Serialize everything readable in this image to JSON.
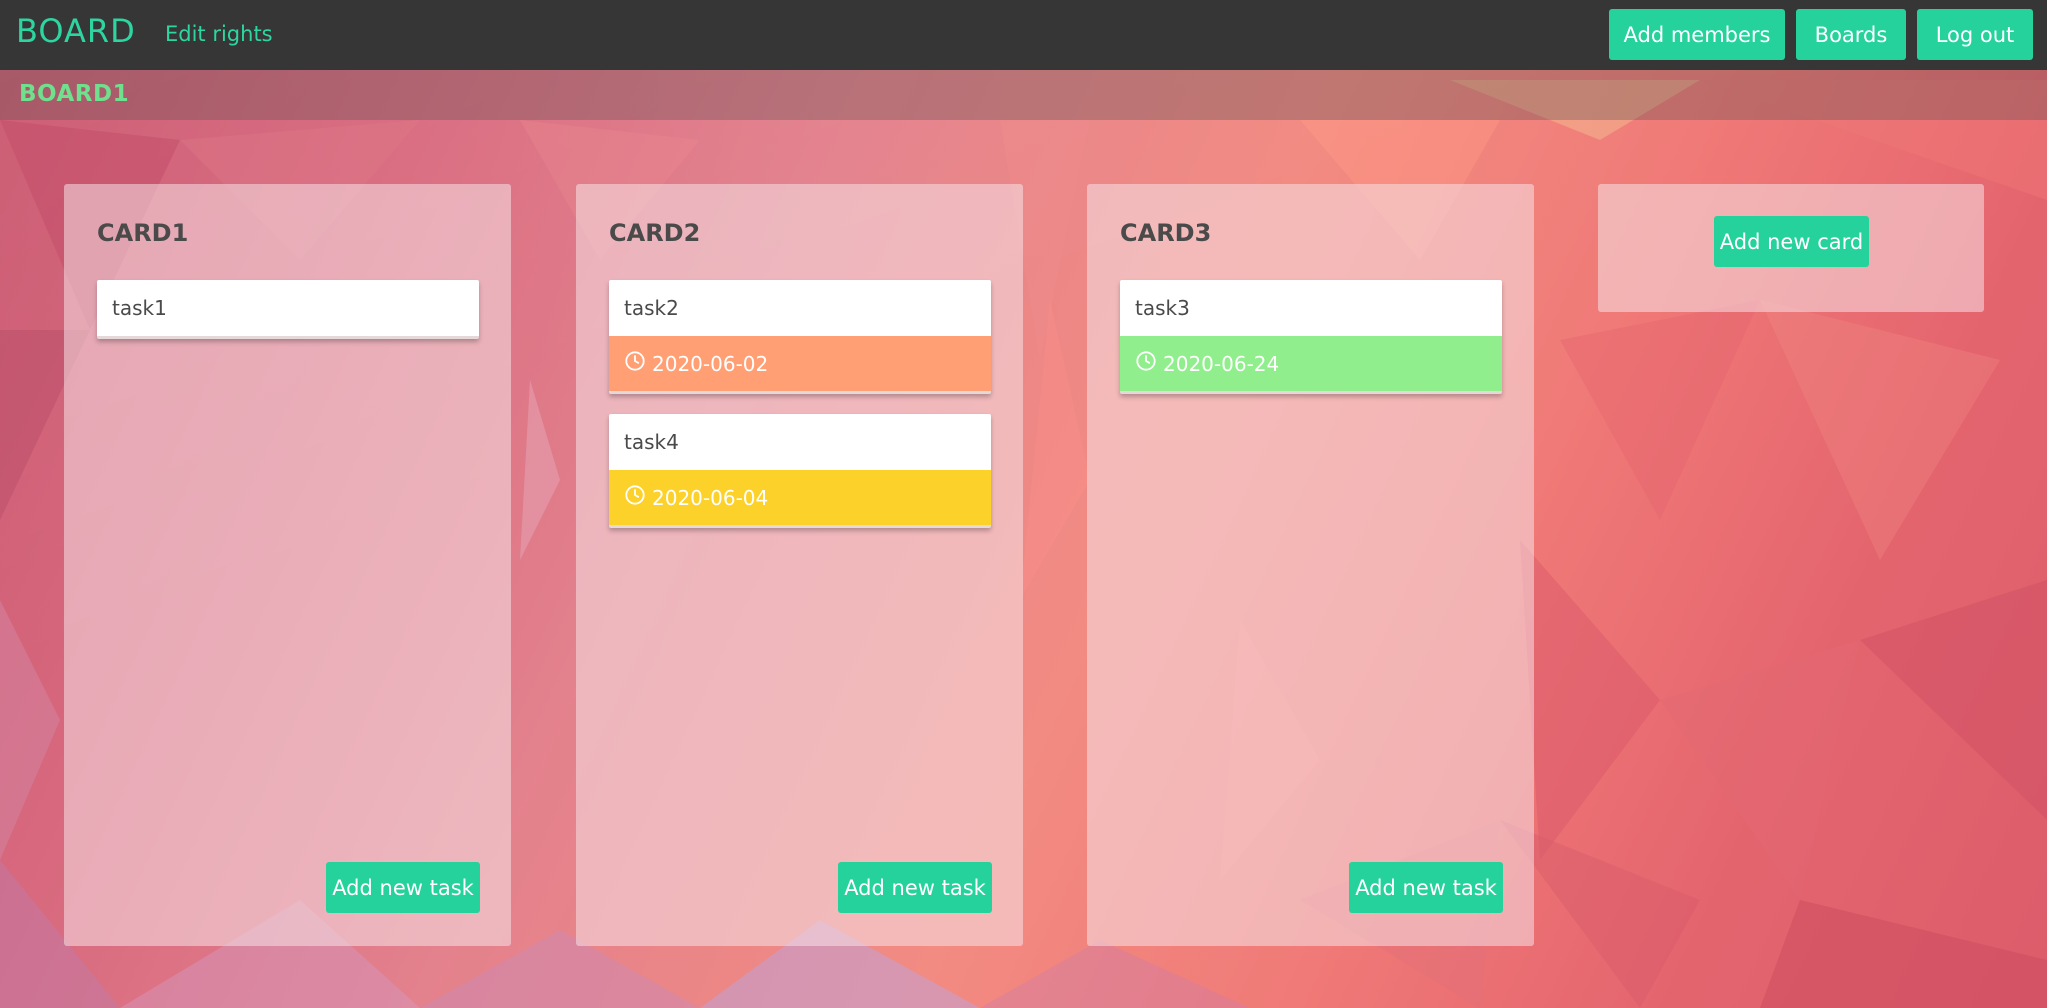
{
  "header": {
    "brand": "BOARD",
    "edit_rights": "Edit rights",
    "add_members": "Add members",
    "boards": "Boards",
    "logout": "Log out"
  },
  "board": {
    "title": "BOARD1"
  },
  "cards": [
    {
      "title": "CARD1",
      "tasks": [
        {
          "name": "task1"
        }
      ],
      "add_task": "Add new task"
    },
    {
      "title": "CARD2",
      "tasks": [
        {
          "name": "task2",
          "date": "2020-06-02",
          "date_color": "#ff9f73"
        },
        {
          "name": "task4",
          "date": "2020-06-04",
          "date_color": "#fcd12a"
        }
      ],
      "add_task": "Add new task"
    },
    {
      "title": "CARD3",
      "tasks": [
        {
          "name": "task3",
          "date": "2020-06-24",
          "date_color": "#90ee8c"
        }
      ],
      "add_task": "Add new task"
    }
  ],
  "add_card": "Add new card",
  "colors": {
    "accent": "#26d29b",
    "topbar": "#363636",
    "board_title": "#6fe08e"
  },
  "icons": {
    "date": "clock-icon"
  }
}
